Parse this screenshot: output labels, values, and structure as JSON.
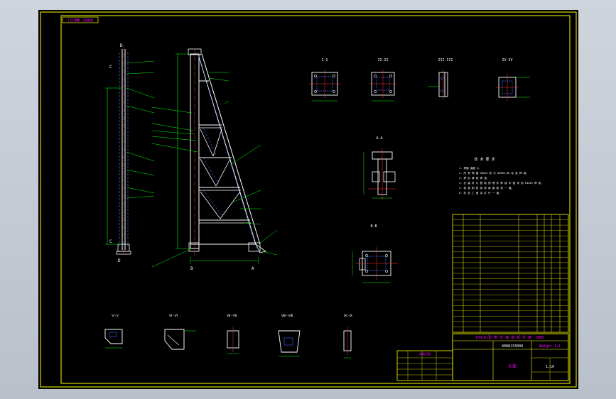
{
  "title_stamp": "(Z)OMR 33000",
  "general_note_title": "技 术 要 求",
  "general_notes": [
    "1. 焊缝 高度 6。",
    "2. 所 有 焊 缝 GB324 执 行 GB985-88 标 准 焊 接。",
    "3. 焊 后 清 除 焊 渣。",
    "4. 安 装 时 与 基 础 预 埋 件 焊 接 牢 固 采 用 E4303 焊 条。",
    "5. 表 面 刷 防 锈 漆 两 遍 面 漆 一 遍。",
    "6. 非 加 工 面 涂 红 丹 一 道。"
  ],
  "section_views": {
    "top_row": [
      "I-I",
      "II-II",
      "III-III",
      "IV-IV"
    ],
    "middle": [
      "A-A",
      "B-B"
    ],
    "bottom_row": [
      "Ⅴ-Ⅴ",
      "Ⅵ-Ⅵ",
      "Ⅶ-Ⅶ",
      "Ⅷ-Ⅷ",
      "Ⅸ-Ⅸ"
    ]
  },
  "title_block": {
    "project": "DTⅡ(A)型 带 式 输 送 机 手 册 -2005",
    "drawing_code": "4008J33000",
    "drawing_name": "头架",
    "weight_label": "Weight 1:1",
    "scale": "1:10"
  },
  "revision_block_title": "修改记录",
  "colors": {
    "frame": "#ffff00",
    "outline": "#ffffff",
    "dimension": "#00ff00",
    "center": "#ff3030",
    "annotation": "#ff00ff",
    "hidden": "#3a6bff"
  }
}
